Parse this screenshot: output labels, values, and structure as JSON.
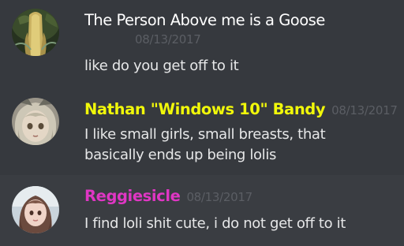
{
  "messages": [
    {
      "username": "The Person Above me is a Goose",
      "timestamp": "08/13/2017",
      "text": [
        "like do you get off to it"
      ]
    },
    {
      "username": "Nathan \"Windows 10\" Bandy",
      "timestamp": "08/13/2017",
      "text": [
        "I like small girls, small breasts, that",
        "basically ends up being lolis"
      ]
    },
    {
      "username": "Reggiesicle",
      "timestamp": "08/13/2017",
      "text": [
        "I find loli shit cute, i do not get off to it"
      ]
    }
  ],
  "colors": {
    "background": "#36393e",
    "hover_background": "#3a3d42",
    "message_text": "#e6e7e8",
    "timestamp": "#5b5e64",
    "username_default": "#ffffff",
    "username_yellow": "#f1f80a",
    "username_pink": "#e036c4"
  }
}
